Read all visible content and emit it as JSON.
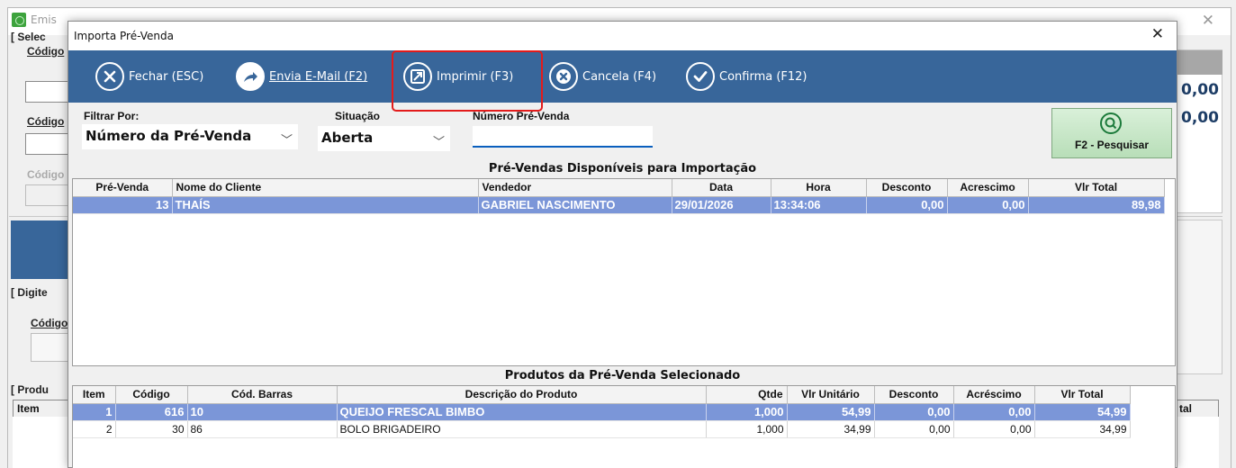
{
  "background": {
    "title": "Emis",
    "labels": [
      "[ Selec",
      "Código",
      "Código",
      "Código",
      "[ Digite",
      "Código",
      "[ Produ"
    ],
    "table_header_item": "Item",
    "table_header_tal": "tal",
    "values": [
      "0,00",
      "0,00"
    ]
  },
  "dialog": {
    "title": "Importa Pré-Venda",
    "toolbar": {
      "fechar": "Fechar (ESC)",
      "email": "Envia E-Mail (F2)",
      "imprimir": "Imprimir (F3)",
      "cancela": "Cancela (F4)",
      "confirma": "Confirma (F12)"
    },
    "filters": {
      "filtrar_label": "Filtrar Por:",
      "filtrar_value": "Número da Pré-Venda",
      "situacao_label": "Situação",
      "situacao_value": "Aberta",
      "numero_label": "Número Pré-Venda",
      "numero_value": ""
    },
    "search_button": "F2 - Pesquisar",
    "presales": {
      "title": "Pré-Vendas Disponíveis para Importação",
      "columns": [
        "Pré-Venda",
        "Nome do Cliente",
        "Vendedor",
        "Data",
        "Hora",
        "Desconto",
        "Acrescimo",
        "Vlr Total"
      ],
      "rows": [
        [
          "13",
          "THAÍS",
          "GABRIEL NASCIMENTO",
          "29/01/2026",
          "13:34:06",
          "0,00",
          "0,00",
          "89,98"
        ]
      ]
    },
    "products": {
      "title": "Produtos da Pré-Venda Selecionado",
      "columns": [
        "Item",
        "Código",
        "Cód. Barras",
        "Descrição do Produto",
        "Qtde",
        "Vlr Unitário",
        "Desconto",
        "Acréscimo",
        "Vlr Total"
      ],
      "rows": [
        [
          "1",
          "616",
          "10",
          "QUEIJO FRESCAL BIMBO",
          "1,000",
          "54,99",
          "0,00",
          "0,00",
          "54,99"
        ],
        [
          "2",
          "30",
          "86",
          "BOLO BRIGADEIRO",
          "1,000",
          "34,99",
          "0,00",
          "0,00",
          "34,99"
        ]
      ]
    }
  }
}
